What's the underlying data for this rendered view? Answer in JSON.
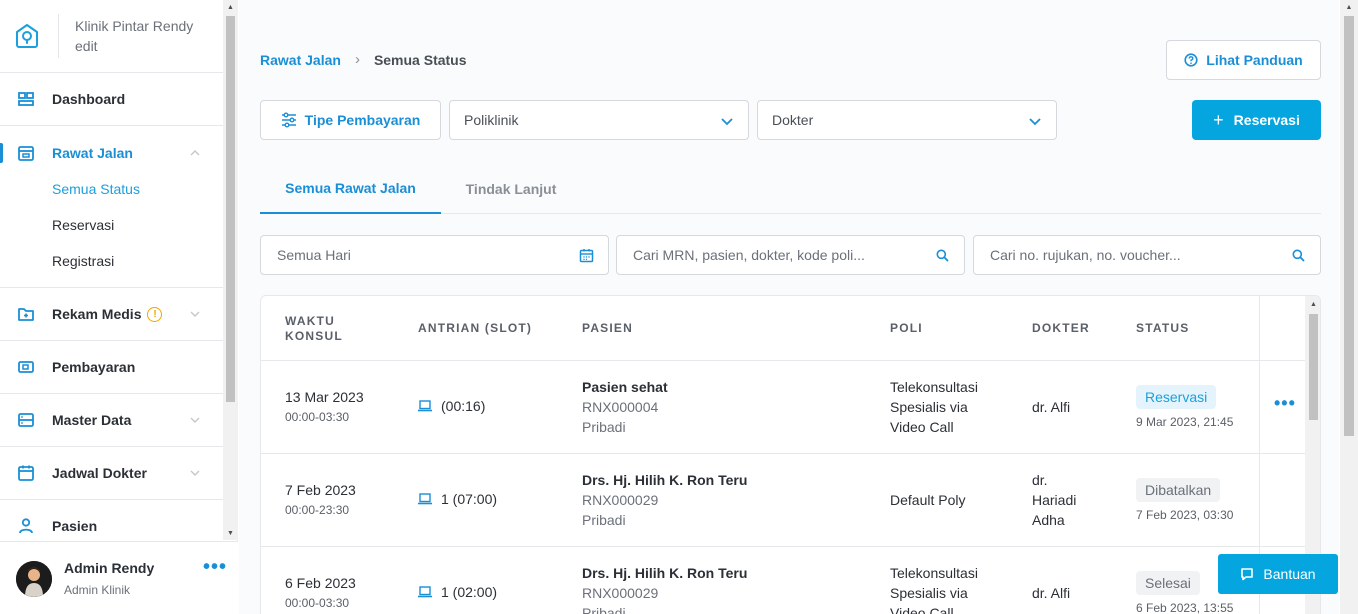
{
  "brand": {
    "title": "Klinik Pintar Rendy edit"
  },
  "sidebar": {
    "items": [
      {
        "label": "Dashboard",
        "icon": "dashboard-icon"
      },
      {
        "label": "Rawat Jalan",
        "icon": "calendar-clinic-icon",
        "active": true,
        "sub": [
          {
            "label": "Semua Status",
            "active": true
          },
          {
            "label": "Reservasi"
          },
          {
            "label": "Registrasi"
          }
        ]
      },
      {
        "label": "Rekam Medis",
        "icon": "folder-plus-icon",
        "warning": "!"
      },
      {
        "label": "Pembayaran",
        "icon": "payment-icon"
      },
      {
        "label": "Master Data",
        "icon": "database-icon"
      },
      {
        "label": "Jadwal Dokter",
        "icon": "calendar-icon"
      },
      {
        "label": "Pasien",
        "icon": "user-icon"
      }
    ]
  },
  "user": {
    "name": "Admin Rendy",
    "role": "Admin Klinik",
    "more": "•••"
  },
  "breadcrumb": {
    "parent": "Rawat Jalan",
    "separator": "›",
    "current": "Semua Status"
  },
  "header": {
    "guide_label": "Lihat Panduan",
    "reservation_label": "Reservasi",
    "reservation_plus": "+"
  },
  "filters": {
    "payment_type_label": "Tipe Pembayaran",
    "poli_placeholder": "Poliklinik",
    "doctor_placeholder": "Dokter"
  },
  "tabs": [
    {
      "label": "Semua Rawat Jalan",
      "active": true
    },
    {
      "label": "Tindak Lanjut"
    }
  ],
  "search": {
    "date_placeholder": "Semua Hari",
    "main_placeholder": "Cari MRN, pasien, dokter, kode poli...",
    "referral_placeholder": "Cari no. rujukan, no. voucher..."
  },
  "table": {
    "columns": [
      "WAKTU KONSUL",
      "ANTRIAN (SLOT)",
      "PASIEN",
      "POLI",
      "DOKTER",
      "STATUS"
    ],
    "rows": [
      {
        "date": "13 Mar 2023",
        "time": "00:00-03:30",
        "queue": "(00:16)",
        "patient": "Pasien sehat",
        "mrn": "RNX000004",
        "payer": "Pribadi",
        "poli": [
          "Telekonsultasi",
          "Spesialis via",
          "Video Call"
        ],
        "doctor": [
          "dr. Alfi"
        ],
        "status": "Reservasi",
        "status_type": "blue",
        "status_time": "9 Mar 2023, 21:45",
        "action": "•••"
      },
      {
        "date": "7 Feb 2023",
        "time": "00:00-23:30",
        "queue": "1 (07:00)",
        "patient": "Drs. Hj. Hilih K. Ron Teru",
        "mrn": "RNX000029",
        "payer": "Pribadi",
        "poli": [
          "Default Poly"
        ],
        "doctor": [
          "dr.",
          "Hariadi",
          "Adha"
        ],
        "status": "Dibatalkan",
        "status_type": "gray",
        "status_time": "7 Feb 2023, 03:30"
      },
      {
        "date": "6 Feb 2023",
        "time": "00:00-03:30",
        "queue": "1 (02:00)",
        "patient": "Drs. Hj. Hilih K. Ron Teru",
        "mrn": "RNX000029",
        "payer": "Pribadi",
        "poli": [
          "Telekonsultasi",
          "Spesialis via",
          "Video Call"
        ],
        "doctor": [
          "dr. Alfi"
        ],
        "status": "Selesai",
        "status_type": "gray",
        "status_time": "6 Feb 2023, 13:55"
      }
    ]
  },
  "help": {
    "label": "Bantuan"
  },
  "colors": {
    "accent": "#1a8fd6",
    "primary_button": "#05a6e0",
    "warning": "#f0a400"
  }
}
